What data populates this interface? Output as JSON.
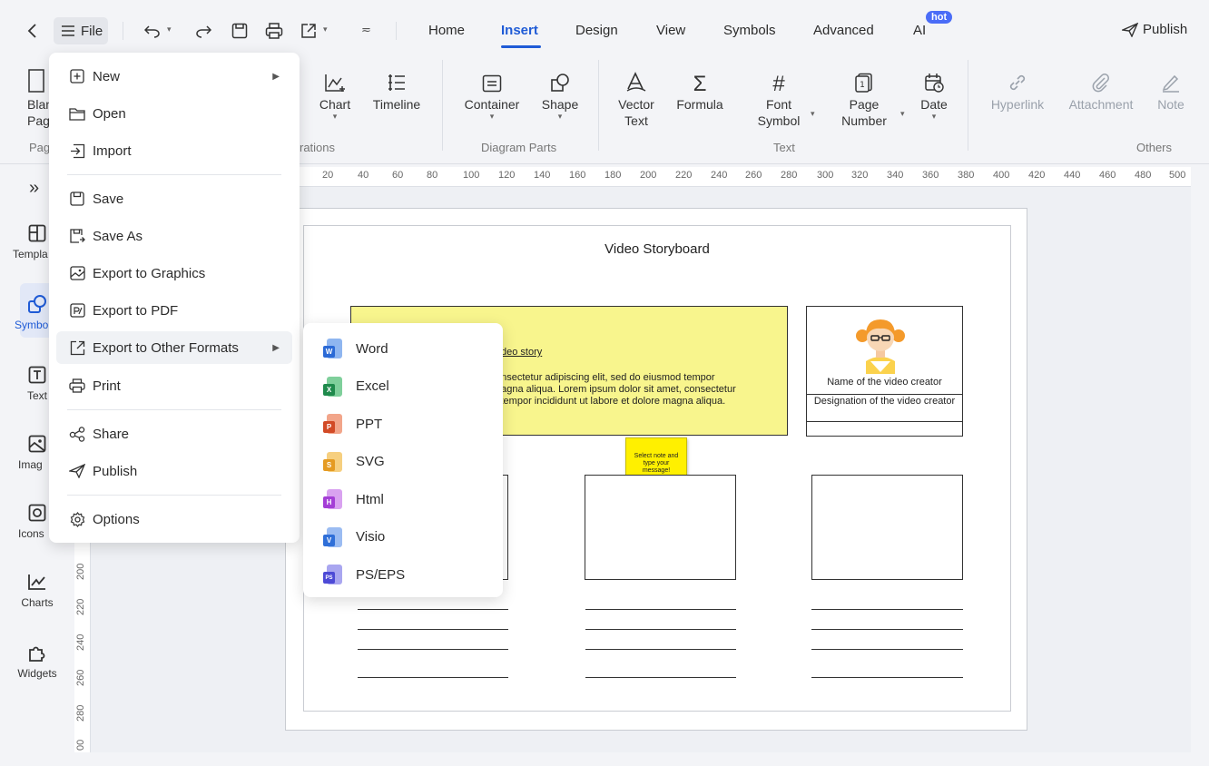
{
  "topbar": {
    "file_label": "File",
    "tabs": [
      {
        "label": "Home"
      },
      {
        "label": "Insert",
        "active": true
      },
      {
        "label": "Design"
      },
      {
        "label": "View"
      },
      {
        "label": "Symbols"
      },
      {
        "label": "Advanced"
      },
      {
        "label": "AI"
      }
    ],
    "ai_badge": "hot",
    "publish_label": "Publish"
  },
  "ribbon": {
    "blank_page": "Blank Page",
    "chart": "Chart",
    "timeline": "Timeline",
    "container": "Container",
    "shape": "Shape",
    "vector_text": "Vector Text",
    "formula": "Formula",
    "font_symbol": "Font Symbol",
    "page_number": "Page Number",
    "date": "Date",
    "hyperlink": "Hyperlink",
    "attachment": "Attachment",
    "note": "Note",
    "groups": {
      "pages": "Pag",
      "illustrations": "rations",
      "diagram_parts": "Diagram Parts",
      "text": "Text",
      "others": "Others"
    }
  },
  "sidebar": {
    "items": [
      {
        "label": "Templa"
      },
      {
        "label": "Symbo"
      },
      {
        "label": "Text"
      },
      {
        "label": "Imag"
      },
      {
        "label": "Icons"
      },
      {
        "label": "Charts"
      },
      {
        "label": "Widgets"
      }
    ]
  },
  "ruler_top": [
    "20",
    "40",
    "60",
    "80",
    "100",
    "120",
    "140",
    "160",
    "180",
    "200",
    "220",
    "240",
    "260",
    "280",
    "300",
    "320",
    "340",
    "360",
    "380",
    "400",
    "420",
    "440",
    "460",
    "480",
    "500"
  ],
  "ruler_left": [
    "200",
    "220",
    "240",
    "260",
    "280",
    "00"
  ],
  "storyboard": {
    "title": "Video Storyboard",
    "story_heading": "deo story",
    "story_line1": "onsectetur adipiscing elit, sed do eiusmod tempor",
    "story_line2": "nagna aliqua. Lorem ipsum dolor sit amet, consectetur",
    "story_line3": "l tempor incididunt ut labore et dolore magna aliqua.",
    "creator_name": "Name of the video creator",
    "creator_designation": "Designation of the video creator",
    "sticky_note": "Select note and type your message!"
  },
  "file_menu": {
    "items": [
      {
        "label": "New",
        "icon": "plus-square-icon",
        "arrow": true
      },
      {
        "label": "Open",
        "icon": "folder-icon"
      },
      {
        "label": "Import",
        "icon": "import-icon"
      },
      {
        "label": "Save",
        "icon": "save-icon"
      },
      {
        "label": "Save As",
        "icon": "save-as-icon"
      },
      {
        "label": "Export to Graphics",
        "icon": "export-image-icon"
      },
      {
        "label": "Export to PDF",
        "icon": "export-pdf-icon"
      },
      {
        "label": "Export to Other Formats",
        "icon": "export-icon",
        "arrow": true
      },
      {
        "label": "Print",
        "icon": "printer-icon"
      },
      {
        "label": "Share",
        "icon": "share-icon"
      },
      {
        "label": "Publish",
        "icon": "send-icon"
      },
      {
        "label": "Options",
        "icon": "gear-icon"
      }
    ]
  },
  "export_submenu": {
    "items": [
      {
        "label": "Word",
        "letter": "W",
        "color": "#2b6ad6",
        "back": "#8fb6f0"
      },
      {
        "label": "Excel",
        "letter": "X",
        "color": "#1f8a4c",
        "back": "#7fcf9b"
      },
      {
        "label": "PPT",
        "letter": "P",
        "color": "#d24a26",
        "back": "#f2a58a"
      },
      {
        "label": "SVG",
        "letter": "S",
        "color": "#e59b22",
        "back": "#f6cf7f"
      },
      {
        "label": "Html",
        "letter": "H",
        "color": "#a43ed6",
        "back": "#d9a2f0"
      },
      {
        "label": "Visio",
        "letter": "V",
        "color": "#2f6fd8",
        "back": "#9bbcf2"
      },
      {
        "label": "PS/EPS",
        "letter": "PS",
        "color": "#4d4ad6",
        "back": "#a9a6f0"
      }
    ]
  }
}
